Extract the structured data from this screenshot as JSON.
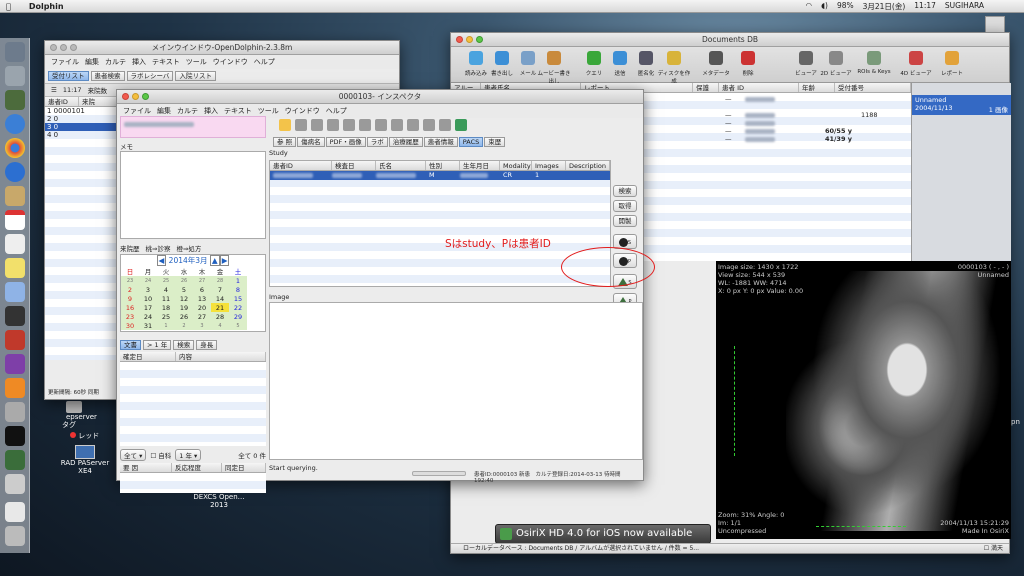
{
  "menubar": {
    "app": "Dolphin",
    "date": "3月21日(金)",
    "time": "11:17",
    "user": "SUGIHARA",
    "battery": "98%"
  },
  "desktop": {
    "items": [
      {
        "label": "epserver"
      },
      {
        "label": "タグ"
      },
      {
        "label": "レッド"
      },
      {
        "label": "RAD PAServer XE4"
      },
      {
        "label": "DEXCS Open…2013"
      },
      {
        "label": "…pn"
      }
    ]
  },
  "main_window": {
    "title": "メインウインドウ-OpenDolphin-2.3.8m",
    "menu": [
      "ファイル",
      "編集",
      "カルテ",
      "挿入",
      "テキスト",
      "ツール",
      "ウインドウ",
      "ヘルプ"
    ],
    "tabs": [
      "受付リスト",
      "患者検索",
      "ラボレシーバ",
      "入院リスト"
    ],
    "time": "11:17",
    "hint": "来院数",
    "columns": [
      "患者ID",
      "来院"
    ],
    "rows": [
      "1 0000101",
      "2 0",
      "3 0",
      "4 0"
    ],
    "footer": "更新間隔: 60秒 同期"
  },
  "inspector": {
    "title": "0000103- インスペクタ",
    "menu": [
      "ファイル",
      "編集",
      "カルテ",
      "挿入",
      "テキスト",
      "ツール",
      "ウインドウ",
      "ヘルプ"
    ],
    "memo_label": "メモ",
    "history_label": "来院歴",
    "history_links": [
      "桃⇒診察",
      "橙⇒処方"
    ],
    "calendar": {
      "title": "2014年3月",
      "weekdays": [
        "日",
        "月",
        "火",
        "水",
        "木",
        "金",
        "土"
      ],
      "weeks": [
        [
          "23",
          "24",
          "25",
          "26",
          "27",
          "28",
          "1"
        ],
        [
          "2",
          "3",
          "4",
          "5",
          "6",
          "7",
          "8"
        ],
        [
          "9",
          "10",
          "11",
          "12",
          "13",
          "14",
          "15"
        ],
        [
          "16",
          "17",
          "18",
          "19",
          "20",
          "21",
          "22"
        ],
        [
          "23",
          "24",
          "25",
          "26",
          "27",
          "28",
          "29"
        ],
        [
          "30",
          "31",
          "1",
          "2",
          "3",
          "4",
          "5"
        ]
      ]
    },
    "doc_tabs": [
      "文書",
      "> 1 年",
      "検索",
      "身長"
    ],
    "doc_columns": [
      "確定日",
      "内容"
    ],
    "filter": {
      "select": "全て",
      "checkbox": "自科",
      "period": "1 年",
      "count": "全て 0 件"
    },
    "attention_columns": [
      "要 因",
      "反応程度",
      "同定日"
    ],
    "tabs": [
      "参 照",
      "傷病名",
      "PDF・画像",
      "ラボ",
      "治療履歴",
      "患者情報",
      "PACS",
      "束歴"
    ],
    "study_label": "Study",
    "study_columns": [
      "患者ID",
      "検査日",
      "氏名",
      "性別",
      "生年月日",
      "Modality",
      "Images",
      "Description"
    ],
    "study_row": {
      "sex": "M",
      "modality": "CR",
      "images": "1"
    },
    "buttons": {
      "search": "検索",
      "get": "取得",
      "open": "開製"
    },
    "small_buttons": [
      "S",
      "P",
      "S",
      "P"
    ],
    "image_label": "Image",
    "status": "Start querying.",
    "footer_info": "患者ID:0000103 新患　カルテ登録日:2014-03-13 待時間 192:40",
    "annotation": "Sはstudy、Pは患者ID"
  },
  "osirix": {
    "title": "Documents DB",
    "toolbar": [
      "読み込み",
      "書き出し",
      "メール",
      "ムービー書き出し",
      "クエリ",
      "送信",
      "匿名化",
      "ディスクを作成",
      "メタデータ",
      "削除",
      "ビューア",
      "2D ビューア",
      "ROIs & Keys",
      "4D ビューア",
      "レポート"
    ],
    "columns": [
      "アルー",
      "患者氏名",
      "レポート",
      "保護",
      "患者 ID",
      "年齢",
      "受付番号"
    ],
    "rows": [
      {
        "prot": "—",
        "age": "",
        "acc": ""
      },
      {
        "prot": "—",
        "age": "",
        "acc": "1188"
      },
      {
        "prot": "—",
        "age": "",
        "acc": ""
      },
      {
        "prot": "—",
        "age": "60/55 y",
        "acc": ""
      },
      {
        "prot": "—",
        "age": "41/39 y",
        "acc": ""
      }
    ],
    "right_panel": {
      "name": "Unnamed",
      "date": "2004/11/13",
      "count": "1 画像"
    },
    "viewer": {
      "tl": [
        "Image size: 1430 x 1722",
        "View size: 544 x 539",
        "WL: -1881 WW: 4714",
        "X: 0 px Y: 0 px Value: 0.00"
      ],
      "tr": [
        "0000103 ( - , - )",
        "Unnamed"
      ],
      "bl": [
        "Zoom: 31% Angle: 0",
        "Im: 1/1",
        "Uncompressed"
      ],
      "br": [
        "2004/11/13 15:21:29",
        "Made In OsiriX"
      ]
    },
    "banner": "OsiriX HD 4.0 for iOS now available",
    "statusbar": "ローカルデータベース : Documents DB / アルバムが選択されていません / 件数 = 5...",
    "close_check": "満天"
  }
}
